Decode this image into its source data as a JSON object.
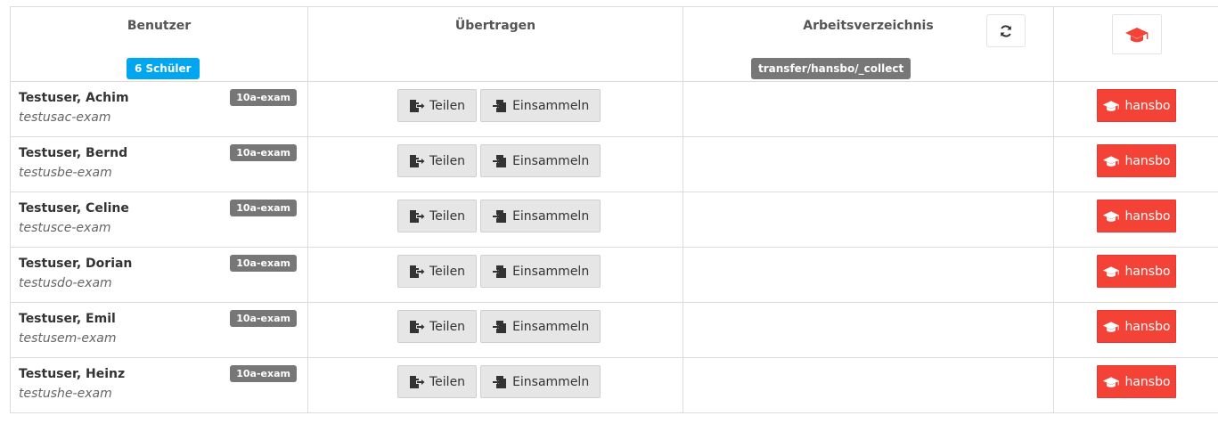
{
  "header": {
    "users_title": "Benutzer",
    "users_count": "6 Schüler",
    "transfer_title": "Übertragen",
    "workdir_title": "Arbeitsverzeichnis",
    "workdir_path": "transfer/hansbo/_collect"
  },
  "buttons": {
    "share": "Teilen",
    "collect": "Einsammeln",
    "teacher": "hansbo"
  },
  "users": [
    {
      "name": "Testuser, Achim",
      "login": "testusac-exam",
      "class": "10a-exam"
    },
    {
      "name": "Testuser, Bernd",
      "login": "testusbe-exam",
      "class": "10a-exam"
    },
    {
      "name": "Testuser, Celine",
      "login": "testusce-exam",
      "class": "10a-exam"
    },
    {
      "name": "Testuser, Dorian",
      "login": "testusdo-exam",
      "class": "10a-exam"
    },
    {
      "name": "Testuser, Emil",
      "login": "testusem-exam",
      "class": "10a-exam"
    },
    {
      "name": "Testuser, Heinz",
      "login": "testushe-exam",
      "class": "10a-exam"
    }
  ],
  "icons": {
    "refresh": "refresh-icon",
    "teacher": "graduation-cap-icon",
    "share": "file-export-icon",
    "collect": "file-import-icon"
  },
  "colors": {
    "count_badge": "#00a6f0",
    "teacher_button": "#f44336",
    "neutral_badge": "#777777"
  }
}
